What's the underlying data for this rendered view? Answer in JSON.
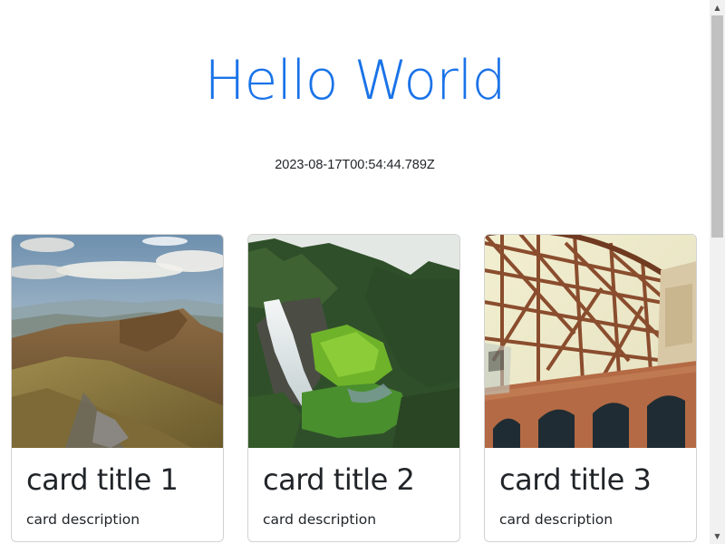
{
  "page": {
    "title": "Hello World",
    "timestamp": "2023-08-17T00:54:44.789Z"
  },
  "colors": {
    "accent": "#1a73e8",
    "text": "#212529"
  },
  "cards": [
    {
      "title": "card title 1",
      "description": "card description",
      "image": "mountain-landscape"
    },
    {
      "title": "card title 2",
      "description": "card description",
      "image": "waterfall-forest"
    },
    {
      "title": "card title 3",
      "description": "card description",
      "image": "bridge-structure"
    }
  ]
}
